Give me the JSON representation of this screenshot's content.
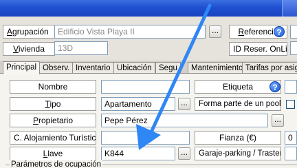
{
  "header": {
    "agrupacion_label_pre": "",
    "agrupacion_label_u": "A",
    "agrupacion_label_post": "grupación",
    "agrupacion_value": "Edificio Vista Playa II",
    "vivienda_label_pre": "",
    "vivienda_label_u": "V",
    "vivienda_label_post": "ivienda",
    "vivienda_value": "13D",
    "referencia_label_pre": "",
    "referencia_label_u": "R",
    "referencia_label_post": "eferencia",
    "id_reser_label": "ID Reser. OnLine",
    "browse_label": "...",
    "help_label": "?"
  },
  "tabs": [
    {
      "label": "Principal"
    },
    {
      "label": "Observ."
    },
    {
      "label": "Inventario"
    },
    {
      "label": "Ubicación"
    },
    {
      "label": "Segu"
    },
    {
      "label": "Mantenimiento"
    },
    {
      "label": "Tarifas por asign"
    }
  ],
  "form": {
    "nombre_label": "Nombre",
    "nombre_value": "",
    "tipo_label_pre": "",
    "tipo_label_u": "T",
    "tipo_label_post": "ipo",
    "tipo_value": "Apartamento",
    "propietario_label_pre": "",
    "propietario_label_u": "P",
    "propietario_label_post": "ropietario",
    "propietario_value": "Pepe Pérez",
    "alojamiento_label": "C. Alojamiento Turístico",
    "alojamiento_value": "",
    "llave_label_pre": "",
    "llave_label_u": "L",
    "llave_label_post": "lave",
    "llave_value": "K844",
    "etiqueta_label": "Etiqueta",
    "pool_label": "Forma parte de un pool",
    "fianza_label": "Fianza (€)",
    "fianza_value": "0",
    "garaje_label": "Garaje-parking / Trastero",
    "parametros_label": "Parámetros de ocupación"
  },
  "colors": {
    "arrow": "#2f86f5",
    "titlebar": "#1f4fd0"
  }
}
